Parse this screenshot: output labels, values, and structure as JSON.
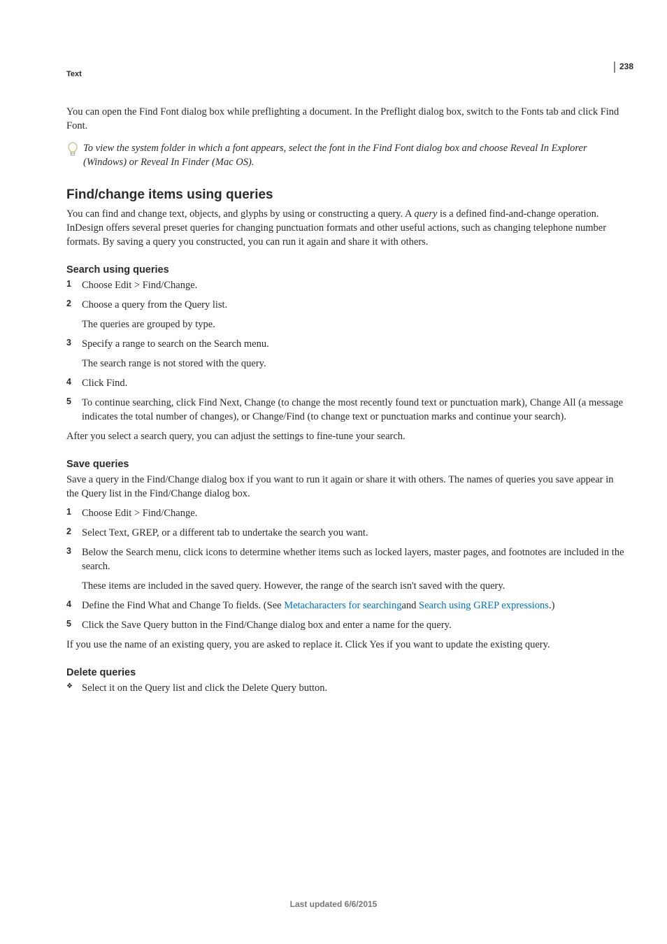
{
  "page_number": "238",
  "section_label": "Text",
  "intro": {
    "p1": "You can open the Find Font dialog box while preflighting a document. In the Preflight dialog box, switch to the Fonts tab and click Find Font.",
    "tip": "To view the system folder in which a font appears, select the font in the Find Font dialog box and choose Reveal In Explorer (Windows) or Reveal In Finder (Mac OS)."
  },
  "h1": "Find/change items using queries",
  "h1_body": {
    "p1_a": "You can find and change text, objects, and glyphs by using or constructing a query. A ",
    "p1_term": "query",
    "p1_b": " is a defined find-and-change operation. InDesign offers several preset queries for changing punctuation formats and other useful actions, such as changing telephone number formats. By saving a query you constructed, you can run it again and share it with others."
  },
  "search": {
    "heading": "Search using queries",
    "steps": {
      "s1": "Choose Edit > Find/Change.",
      "s2": "Choose a query from the Query list.",
      "s2_sub": "The queries are grouped by type.",
      "s3": "Specify a range to search on the Search menu.",
      "s3_sub": "The search range is not stored with the query.",
      "s4": "Click Find.",
      "s5": "To continue searching, click Find Next, Change (to change the most recently found text or punctuation mark), Change All (a message indicates the total number of changes), or Change/Find (to change text or punctuation marks and continue your search)."
    },
    "after": "After you select a search query, you can adjust the settings to fine-tune your search."
  },
  "save": {
    "heading": "Save queries",
    "intro": "Save a query in the Find/Change dialog box if you want to run it again or share it with others. The names of queries you save appear in the Query list in the Find/Change dialog box.",
    "steps": {
      "s1": "Choose Edit > Find/Change.",
      "s2": "Select Text, GREP, or a different tab to undertake the search you want.",
      "s3": "Below the Search menu, click icons to determine whether items such as locked layers, master pages, and footnotes are included in the search.",
      "s3_sub": "These items are included in the saved query. However, the range of the search isn't saved with the query.",
      "s4_a": "Define the Find What and Change To fields. (See ",
      "s4_link1": "Metacharacters for searching",
      "s4_mid": "and ",
      "s4_link2": "Search using GREP expressions",
      "s4_end": ".)",
      "s5": "Click the Save Query button in the Find/Change dialog box and enter a name for the query."
    },
    "after": "If you use the name of an existing query, you are asked to replace it. Click Yes if you want to update the existing query."
  },
  "delete": {
    "heading": "Delete queries",
    "item": "Select it on the Query list and click the Delete Query button."
  },
  "footer": "Last updated 6/6/2015"
}
